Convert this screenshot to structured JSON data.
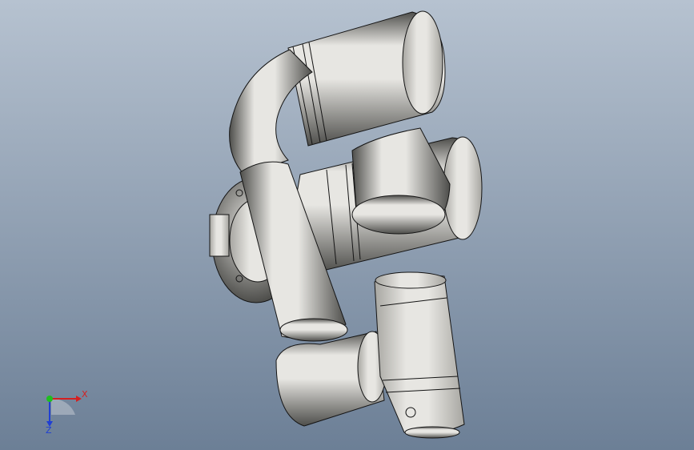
{
  "viewport": {
    "background_top": "#b6c2d0",
    "background_bottom": "#6c7f96"
  },
  "model": {
    "name": "robot-arm",
    "color_light": "#e7e6e2",
    "color_mid": "#a7a6a1",
    "color_dark": "#4e4e4b",
    "edge_color": "#141414"
  },
  "triad": {
    "x_label": "X",
    "z_label": "Z",
    "x_color": "#d42020",
    "y_color": "#1fbf1f",
    "z_color": "#1f3fd4"
  }
}
